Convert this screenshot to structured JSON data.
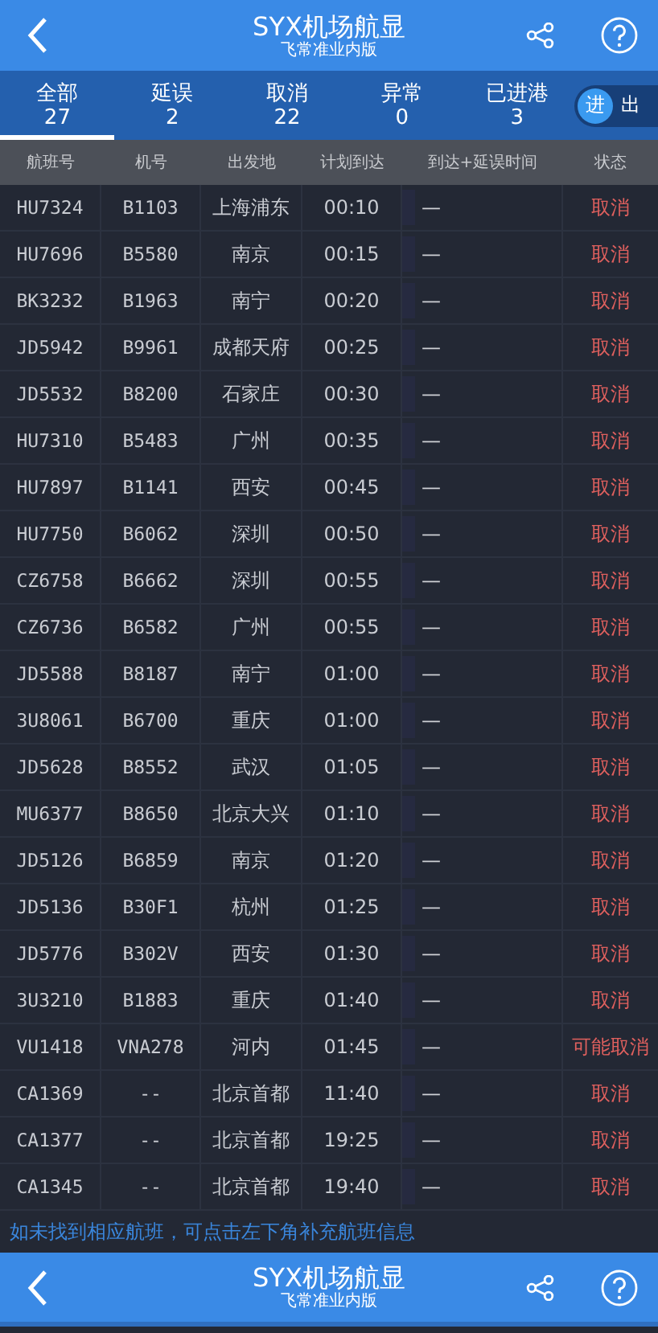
{
  "header": {
    "title": "SYX机场航显",
    "subtitle": "飞常准业内版"
  },
  "tabs": [
    {
      "label": "全部",
      "count": "27",
      "selected": true
    },
    {
      "label": "延误",
      "count": "2",
      "selected": false
    },
    {
      "label": "取消",
      "count": "22",
      "selected": false
    },
    {
      "label": "异常",
      "count": "0",
      "selected": false
    },
    {
      "label": "已进港",
      "count": "3",
      "selected": false
    }
  ],
  "direction_toggle": [
    {
      "label": "进",
      "selected": true
    },
    {
      "label": "出",
      "selected": false
    }
  ],
  "table": {
    "columns": [
      "航班号",
      "机号",
      "出发地",
      "计划到达",
      "到达+延误时间",
      "状态"
    ],
    "rows": [
      {
        "flight": "HU7324",
        "aircraft": "B1103",
        "origin": "上海浦东",
        "scheduled": "00:10",
        "actual": "—",
        "status": "取消"
      },
      {
        "flight": "HU7696",
        "aircraft": "B5580",
        "origin": "南京",
        "scheduled": "00:15",
        "actual": "—",
        "status": "取消"
      },
      {
        "flight": "BK3232",
        "aircraft": "B1963",
        "origin": "南宁",
        "scheduled": "00:20",
        "actual": "—",
        "status": "取消"
      },
      {
        "flight": "JD5942",
        "aircraft": "B9961",
        "origin": "成都天府",
        "scheduled": "00:25",
        "actual": "—",
        "status": "取消"
      },
      {
        "flight": "JD5532",
        "aircraft": "B8200",
        "origin": "石家庄",
        "scheduled": "00:30",
        "actual": "—",
        "status": "取消"
      },
      {
        "flight": "HU7310",
        "aircraft": "B5483",
        "origin": "广州",
        "scheduled": "00:35",
        "actual": "—",
        "status": "取消"
      },
      {
        "flight": "HU7897",
        "aircraft": "B1141",
        "origin": "西安",
        "scheduled": "00:45",
        "actual": "—",
        "status": "取消"
      },
      {
        "flight": "HU7750",
        "aircraft": "B6062",
        "origin": "深圳",
        "scheduled": "00:50",
        "actual": "—",
        "status": "取消"
      },
      {
        "flight": "CZ6758",
        "aircraft": "B6662",
        "origin": "深圳",
        "scheduled": "00:55",
        "actual": "—",
        "status": "取消"
      },
      {
        "flight": "CZ6736",
        "aircraft": "B6582",
        "origin": "广州",
        "scheduled": "00:55",
        "actual": "—",
        "status": "取消"
      },
      {
        "flight": "JD5588",
        "aircraft": "B8187",
        "origin": "南宁",
        "scheduled": "01:00",
        "actual": "—",
        "status": "取消"
      },
      {
        "flight": "3U8061",
        "aircraft": "B6700",
        "origin": "重庆",
        "scheduled": "01:00",
        "actual": "—",
        "status": "取消"
      },
      {
        "flight": "JD5628",
        "aircraft": "B8552",
        "origin": "武汉",
        "scheduled": "01:05",
        "actual": "—",
        "status": "取消"
      },
      {
        "flight": "MU6377",
        "aircraft": "B8650",
        "origin": "北京大兴",
        "scheduled": "01:10",
        "actual": "—",
        "status": "取消"
      },
      {
        "flight": "JD5126",
        "aircraft": "B6859",
        "origin": "南京",
        "scheduled": "01:20",
        "actual": "—",
        "status": "取消"
      },
      {
        "flight": "JD5136",
        "aircraft": "B30F1",
        "origin": "杭州",
        "scheduled": "01:25",
        "actual": "—",
        "status": "取消"
      },
      {
        "flight": "JD5776",
        "aircraft": "B302V",
        "origin": "西安",
        "scheduled": "01:30",
        "actual": "—",
        "status": "取消"
      },
      {
        "flight": "3U3210",
        "aircraft": "B1883",
        "origin": "重庆",
        "scheduled": "01:40",
        "actual": "—",
        "status": "取消"
      },
      {
        "flight": "VU1418",
        "aircraft": "VNA278",
        "origin": "河内",
        "scheduled": "01:45",
        "actual": "—",
        "status": "可能取消"
      },
      {
        "flight": "CA1369",
        "aircraft": "--",
        "origin": "北京首都",
        "scheduled": "11:40",
        "actual": "—",
        "status": "取消"
      },
      {
        "flight": "CA1377",
        "aircraft": "--",
        "origin": "北京首都",
        "scheduled": "19:25",
        "actual": "—",
        "status": "取消"
      },
      {
        "flight": "CA1345",
        "aircraft": "--",
        "origin": "北京首都",
        "scheduled": "19:40",
        "actual": "—",
        "status": "取消"
      }
    ]
  },
  "notice": "如未找到相应航班，可点击左下角补充航班信息",
  "bottom_bar": {
    "title": "SYX机场航显",
    "subtitle": "飞常准业内版"
  }
}
